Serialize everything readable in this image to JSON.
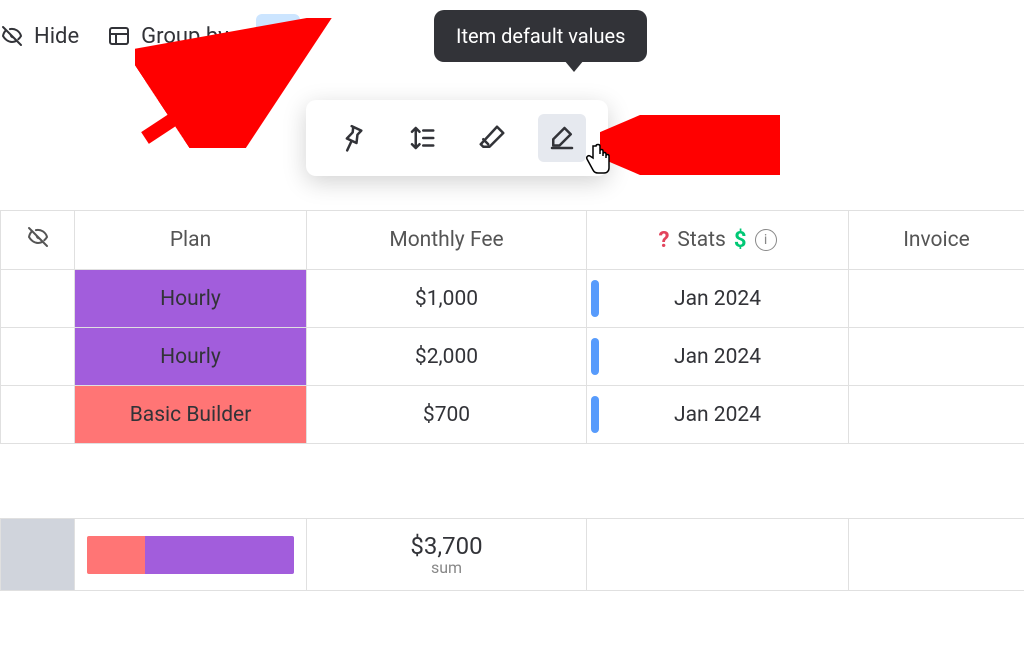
{
  "toolbar": {
    "hide_label": "Hide",
    "group_by_label": "Group by"
  },
  "tooltip_text": "Item default values",
  "popover": {
    "pin": "pin",
    "height": "row-height",
    "clean": "eraser",
    "defaults": "edit-defaults"
  },
  "columns": {
    "plan": "Plan",
    "monthly_fee": "Monthly Fee",
    "stats": "Stats",
    "invoice": "Invoice"
  },
  "rows": [
    {
      "plan": "Hourly",
      "plan_color": "purple",
      "fee": "$1,000",
      "stat": "Jan 2024"
    },
    {
      "plan": "Hourly",
      "plan_color": "purple",
      "fee": "$2,000",
      "stat": "Jan 2024"
    },
    {
      "plan": "Basic Builder",
      "plan_color": "coral",
      "fee": "$700",
      "stat": "Jan 2024"
    }
  ],
  "summary": {
    "fee_total": "$3,700",
    "fee_label": "sum"
  },
  "colors": {
    "purple": "#a25ddc",
    "coral": "#ff7575",
    "blue_bar": "#579bfc",
    "highlight": "#cce5ff"
  }
}
